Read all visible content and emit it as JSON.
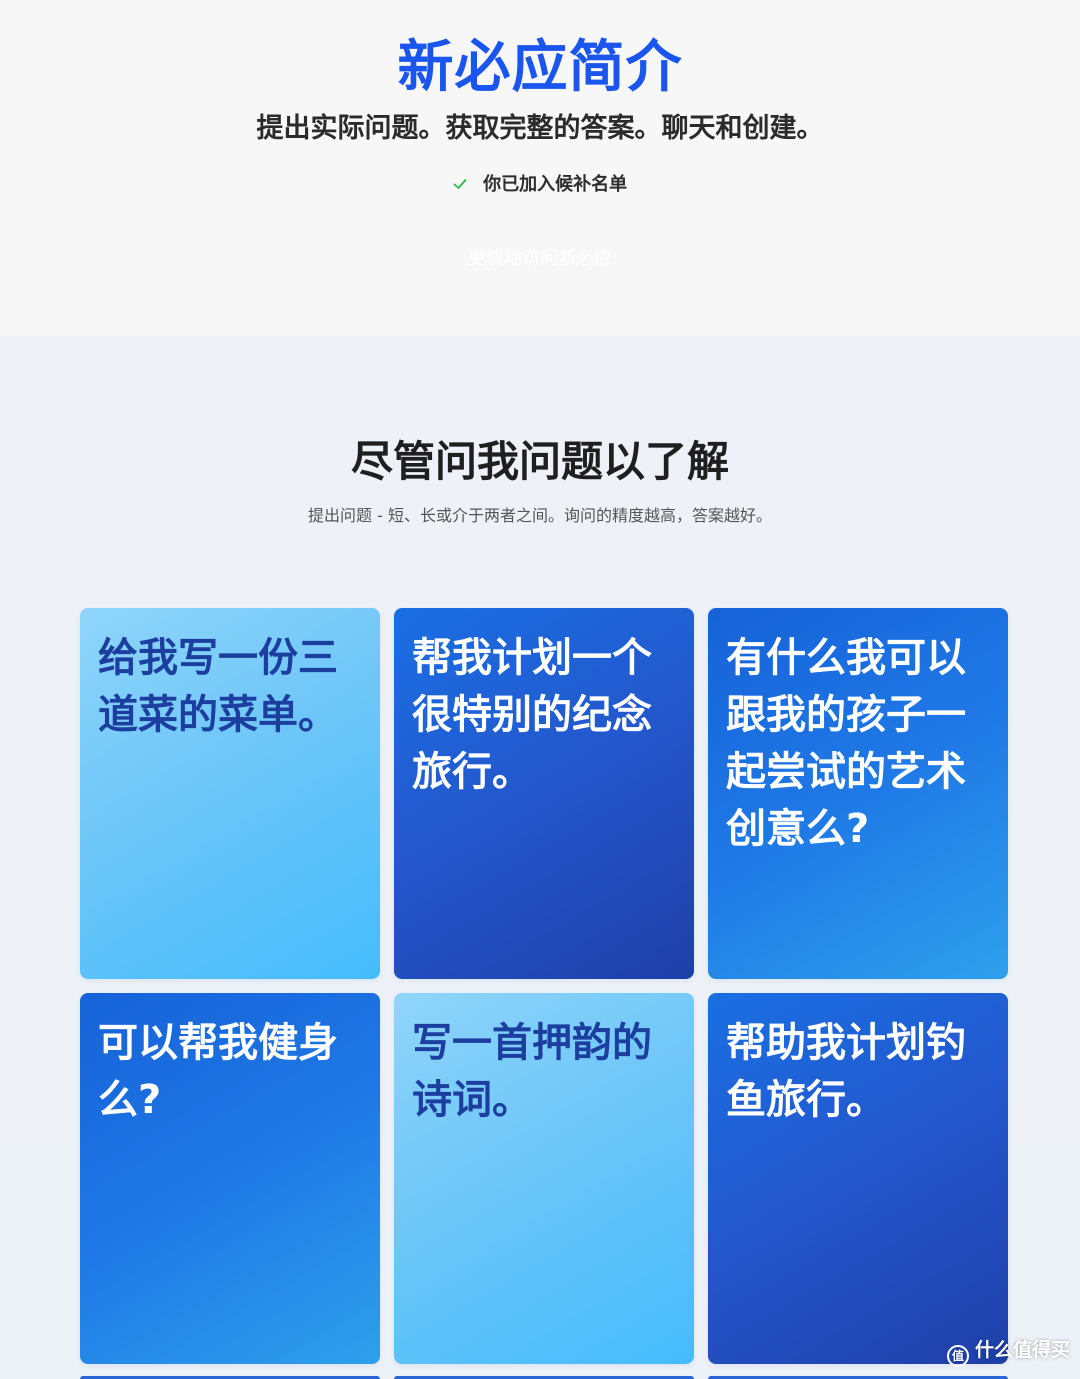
{
  "hero": {
    "title": "新必应简介",
    "subtitle": "提出实际问题。获取完整的答案。聊天和创建。",
    "waitlist_text": "你已加入候补名单",
    "faster_access_link": "更快地访问新必应"
  },
  "section": {
    "title": "尽管问我问题以了解",
    "description": "提出问题 - 短、长或介于两者之间。询问的精度越高，答案越好。"
  },
  "cards": [
    {
      "text": "给我写一份三道菜的菜单。",
      "style": "light"
    },
    {
      "text": "帮我计划一个很特别的纪念旅行。",
      "style": "dark"
    },
    {
      "text": "有什么我可以跟我的孩子一起尝试的艺术创意么?",
      "style": "mid"
    },
    {
      "text": "可以帮我健身么?",
      "style": "mid"
    },
    {
      "text": "写一首押韵的诗词。",
      "style": "light"
    },
    {
      "text": "帮助我计划钓鱼旅行。",
      "style": "dark"
    }
  ],
  "watermark": {
    "logo_glyph": "值",
    "text": "什么值得买"
  },
  "colors": {
    "brand_blue": "#1a56ee",
    "check_green": "#2db84a",
    "card_light_text": "#1c3e9e"
  },
  "icons": {
    "waitlist": "check-icon"
  }
}
